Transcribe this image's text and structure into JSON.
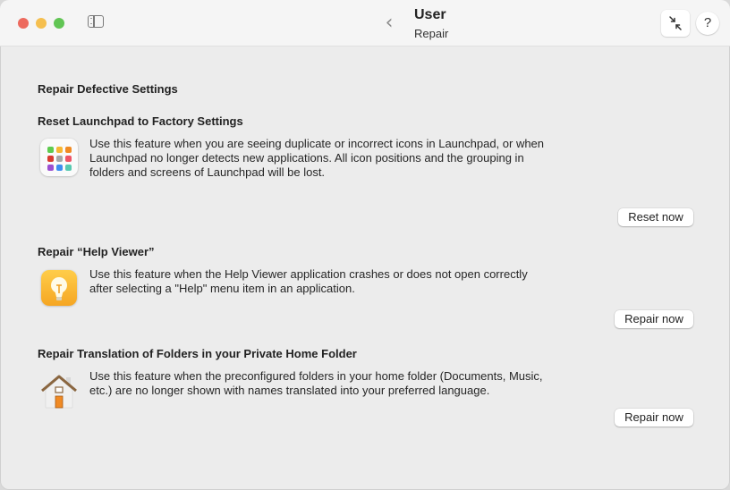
{
  "window": {
    "title": "User",
    "subtitle": "Repair",
    "back_icon": "chevron-left-icon",
    "back_glyph": "‹",
    "sidebar_icon": "sidebar-toggle-icon",
    "collapse_icon": "collapse-arrows-icon",
    "help_label": "?"
  },
  "main": {
    "heading": "Repair Defective Settings",
    "sections": [
      {
        "title": "Reset Launchpad to Factory Settings",
        "icon": "launchpad-icon",
        "description": "Use this feature when you are seeing duplicate or incorrect icons in Launchpad, or when Launchpad no longer detects new applications. All icon positions and the grouping in folders and screens of Launchpad will be lost.",
        "button": "Reset now"
      },
      {
        "title": "Repair “Help Viewer”",
        "icon": "help-viewer-icon",
        "description": "Use this feature when the Help Viewer application crashes or does not open correctly after selecting a \"Help\" menu item in an application.",
        "button": "Repair now"
      },
      {
        "title": "Repair Translation of Folders in your Private Home Folder",
        "icon": "home-folder-icon",
        "description": "Use this feature when the preconfigured folders in your home folder (Documents, Music, etc.) are no longer shown with names translated into your preferred language.",
        "button": "Repair now"
      }
    ]
  },
  "colors": {
    "close": "#ed6a5e",
    "minimize": "#f5bf4f",
    "maximize": "#61c554",
    "launchpad_tiles": [
      "#5ecb4f",
      "#f7b733",
      "#f08a24",
      "#d93b30",
      "#a6a6a6",
      "#ef5466",
      "#9b4fd1",
      "#3d8ef0",
      "#58c9b0"
    ],
    "help_viewer": "#f5a623",
    "home_roof": "#8a6640",
    "home_door": "#f08a24"
  }
}
